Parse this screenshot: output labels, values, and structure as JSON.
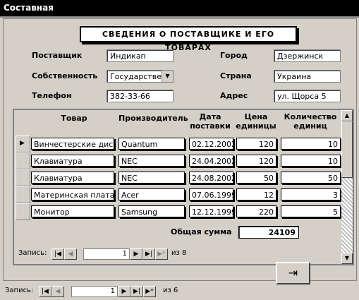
{
  "window": {
    "title": "Составная"
  },
  "header": {
    "title": "СВЕДЕНИЯ О ПОСТАВЩИКЕ И ЕГО ТОВАРАХ"
  },
  "supplier": {
    "label_supplier": "Поставщик",
    "value_supplier": "Индикап",
    "label_ownership": "Собственность",
    "value_ownership": "Государственно",
    "label_phone": "Телефон",
    "value_phone": "382-33-66",
    "label_city": "Город",
    "value_city": "Дзержинск",
    "label_country": "Страна",
    "value_country": "Украина",
    "label_address": "Адрес",
    "value_address": "ул. Щорса 5"
  },
  "table": {
    "columns": [
      "Товар",
      "Производитель",
      "Дата поставки",
      "Цена единицы",
      "Количество единиц"
    ],
    "rows": [
      [
        "Винчестерские диски",
        "Quantum",
        "02.12.2002",
        "120",
        "10"
      ],
      [
        "Клавиатура",
        "NEC",
        "24.04.2002",
        "120",
        "10"
      ],
      [
        "Клавиатура",
        "NEC",
        "24.08.2002",
        "50",
        "50"
      ],
      [
        "Материнская плата",
        "Acer",
        "07.06.1999",
        "12",
        "3"
      ],
      [
        "Монитор",
        "Samsung",
        "12.12.1999",
        "220",
        "5"
      ]
    ],
    "total_label": "Общая сумма",
    "total_value": "24109"
  },
  "subnav": {
    "label": "Запись:",
    "current": "1",
    "of_label": "из 8"
  },
  "mainnav": {
    "label": "Запись:",
    "current": "1",
    "of_label": "из 6"
  },
  "icons": {
    "record_selector": "current-record-arrow-icon",
    "exit": "exit-door-icon"
  }
}
